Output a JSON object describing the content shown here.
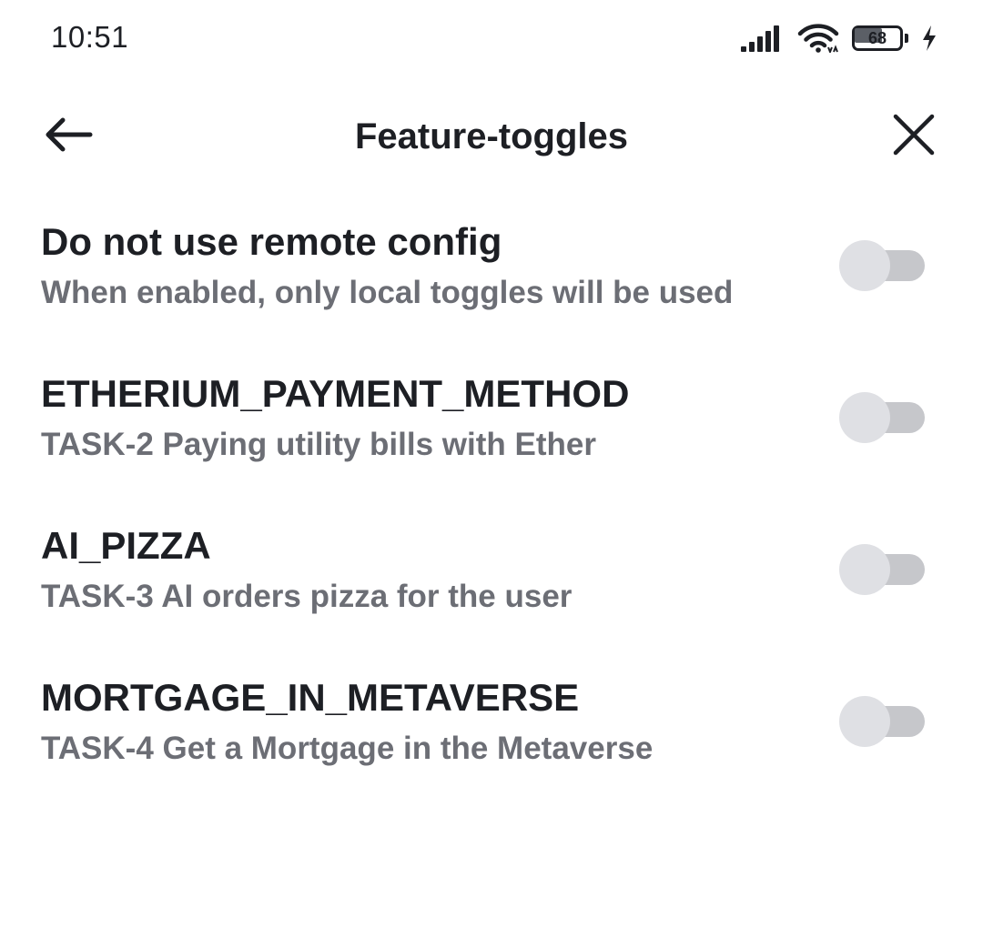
{
  "status_bar": {
    "time": "10:51",
    "battery_level": "68",
    "battery_fraction": 0.68,
    "icons": [
      "signal-icon",
      "wifi-icon",
      "battery-icon",
      "charging-icon"
    ]
  },
  "app_bar": {
    "title": "Feature-toggles",
    "back_icon": "arrow-left-icon",
    "close_icon": "close-icon"
  },
  "toggles": [
    {
      "title": "Do not use remote config",
      "description": "When enabled, only local toggles will be used",
      "enabled": false
    },
    {
      "title": "ETHERIUM_PAYMENT_METHOD",
      "description": "TASK-2 Paying utility bills with Ether",
      "enabled": false
    },
    {
      "title": "AI_PIZZA",
      "description": "TASK-3 AI orders pizza for the user",
      "enabled": false
    },
    {
      "title": "MORTGAGE_IN_METAVERSE",
      "description": "TASK-4 Get a Mortgage in the Metaverse",
      "enabled": false
    }
  ],
  "colors": {
    "text_primary": "#1d1f24",
    "text_secondary": "#6c6e75",
    "switch_track_off": "#c6c7cb",
    "switch_thumb_off": "#dfe0e4",
    "background": "#ffffff"
  }
}
